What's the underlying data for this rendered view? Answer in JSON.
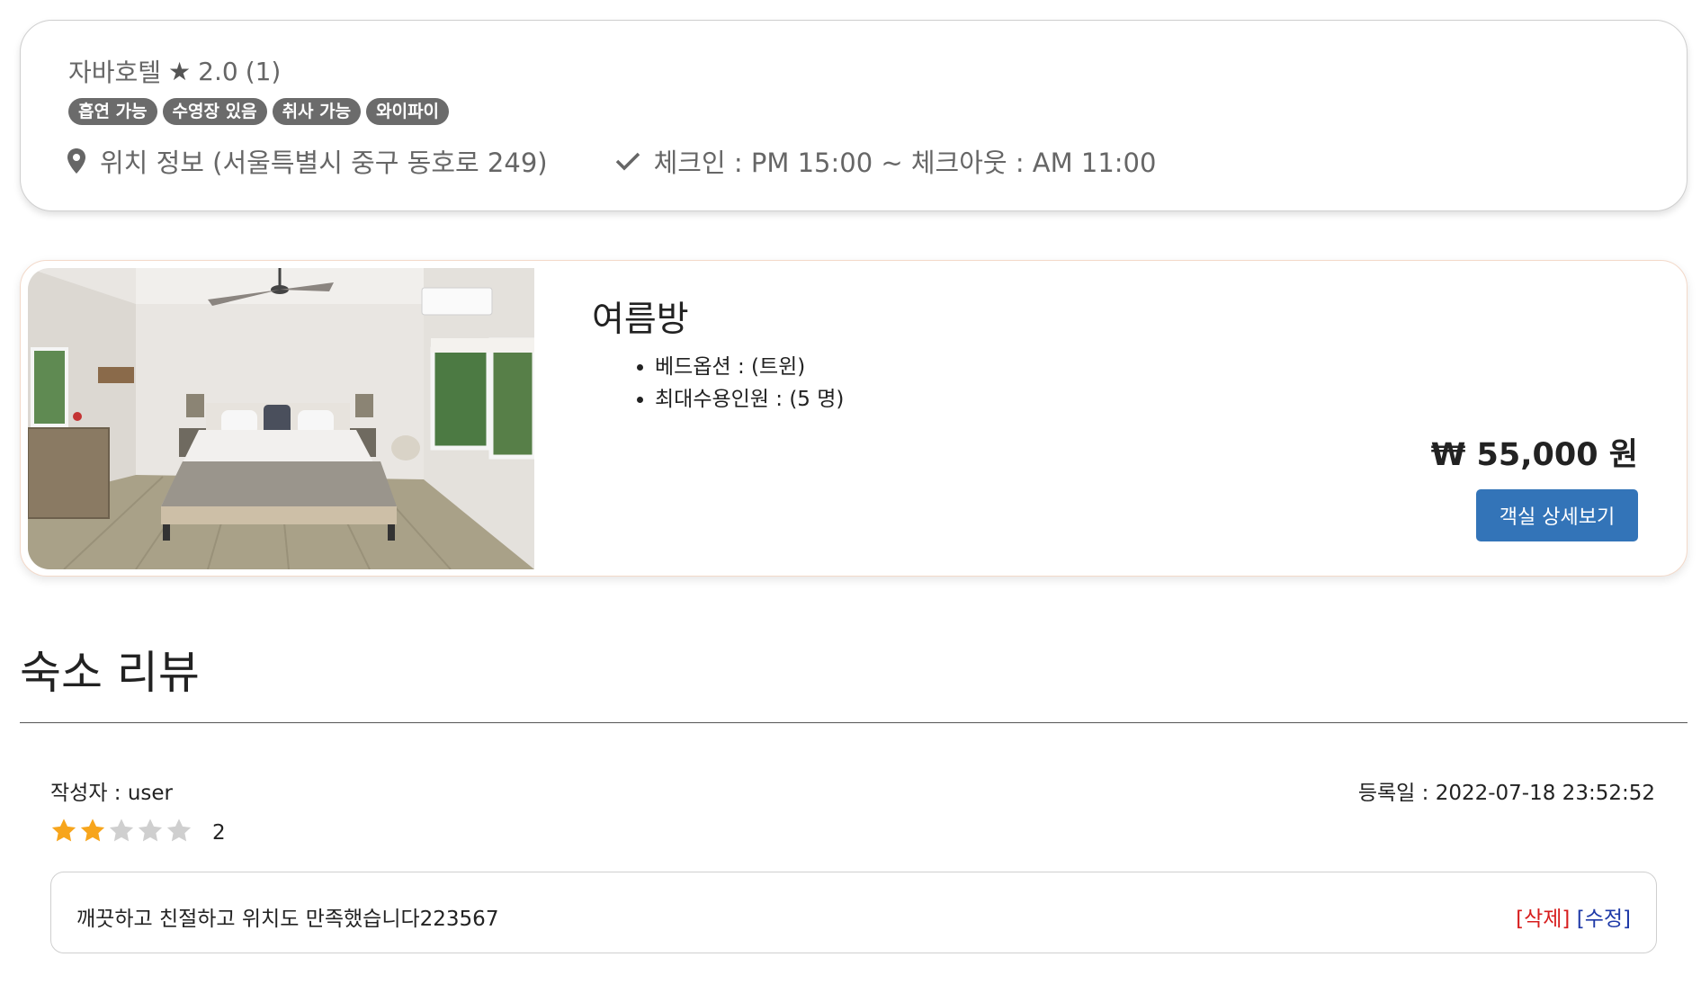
{
  "hotel": {
    "name": "자바호텔",
    "star_icon": "★",
    "rating": "2.0",
    "review_count": "(1)",
    "tags": [
      "흡연 가능",
      "수영장 있음",
      "취사 가능",
      "와이파이"
    ],
    "location_text": "위치 정보 (서울특별시 중구 동호로 249)",
    "checkin_text": "체크인 : PM 15:00 ~ 체크아웃 : AM 11:00",
    "icons": {
      "location": "location-pin-icon",
      "check": "checkmark-icon"
    }
  },
  "room": {
    "name": "여름방",
    "specs": [
      "베드옵션 : (트윈)",
      "최대수용인원 : (5 명)"
    ],
    "price": "₩ 55,000 원",
    "detail_button_label": "객실 상세보기",
    "photo_alt": "bedroom-photo"
  },
  "reviews": {
    "section_title": "숙소 리뷰",
    "items": [
      {
        "author": "작성자 : user",
        "date": "등록일 : 2022-07-18 23:52:52",
        "stars_filled": 2,
        "stars_total": 5,
        "score": "2",
        "content": "깨끗하고 친절하고 위치도 만족했습니다223567",
        "delete_label": "[삭제]",
        "edit_label": "[수정]"
      }
    ]
  },
  "colors": {
    "tag_bg": "#6b6b6b",
    "button_bg": "#3374b8",
    "star_filled": "#f7a51c",
    "star_empty": "#cfcfcf",
    "delete_link": "#d71d1d",
    "edit_link": "#1f3aa8"
  }
}
